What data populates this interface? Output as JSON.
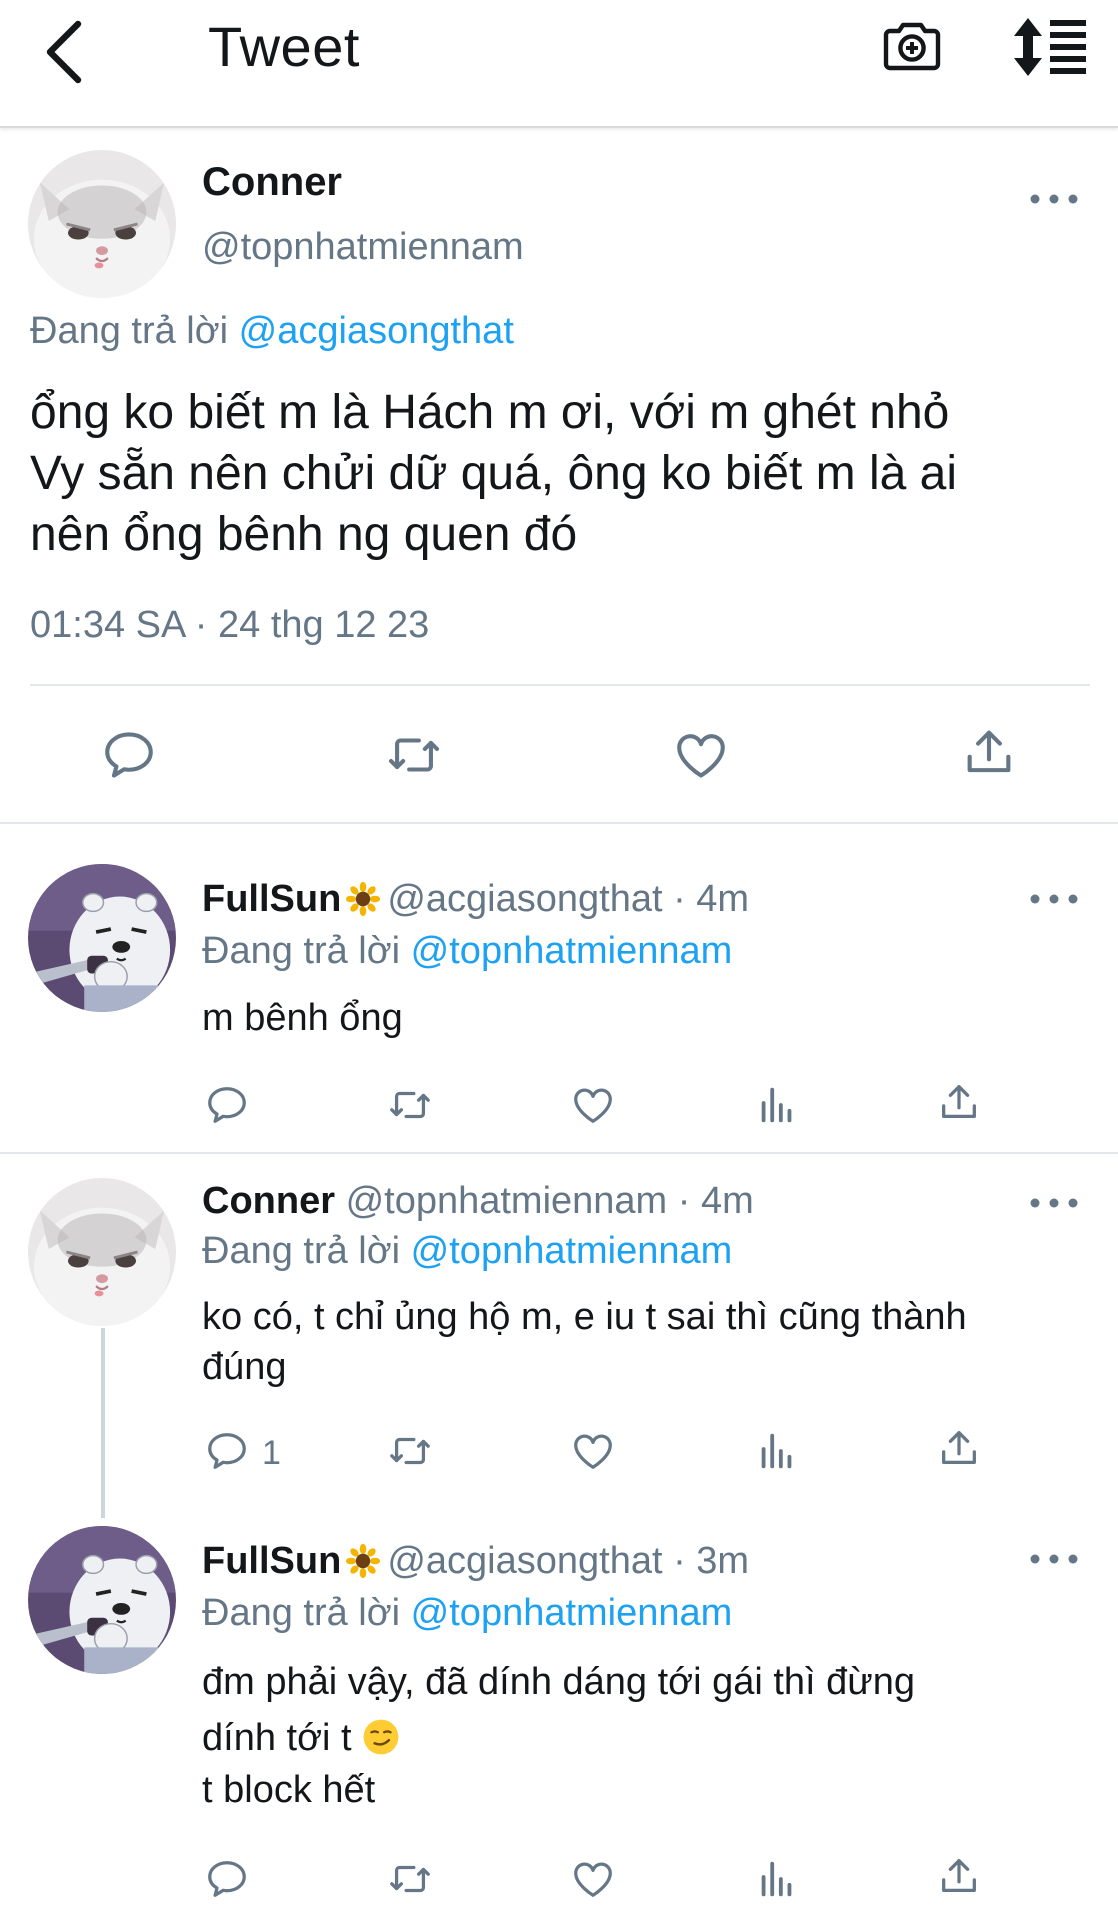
{
  "topbar": {
    "title": "Tweet",
    "back_icon": "chevron-left-icon",
    "camera_icon": "camera-add-icon",
    "sort_icon": "sort-icon"
  },
  "main_tweet": {
    "name": "Conner",
    "handle": "@topnhatmiennam",
    "replying_prefix": "Đang trả lời ",
    "replying_to": "@acgiasongthat",
    "lines": [
      "ổng ko biết m là Hách m ơi, với m ghét nhỏ",
      "Vy sẵn nên chửi dữ quá, ông ko biết m là ai",
      "nên ổng bênh ng quen đó"
    ],
    "timestamp": "01:34 SA · 24 thg 12 23"
  },
  "replies": [
    {
      "name": "FullSun",
      "handle_time": "@acgiasongthat · 4m",
      "replying_prefix": "Đang trả lời ",
      "replying_to": "@topnhatmiennam",
      "lines": [
        "m bênh ổng"
      ],
      "reply_count": ""
    },
    {
      "name": "Conner",
      "handle_time": "@topnhatmiennam · 4m",
      "replying_prefix": "Đang trả lời ",
      "replying_to": "@topnhatmiennam",
      "lines": [
        "ko có, t chỉ ủng hộ m, e iu t sai thì cũng thành",
        "đúng"
      ],
      "reply_count": "1"
    },
    {
      "name": "FullSun",
      "handle_time": "@acgiasongthat · 3m",
      "replying_prefix": "Đang trả lời ",
      "replying_to": "@topnhatmiennam",
      "lines": [
        "đm phải vậy, đã dính dáng tới gái thì đừng",
        "dính tới t",
        "t block hết"
      ],
      "reply_count": ""
    }
  ],
  "colors": {
    "link": "#1da1f2",
    "secondary_text": "#657786",
    "primary_text": "#14171a",
    "icon": "#657786"
  }
}
